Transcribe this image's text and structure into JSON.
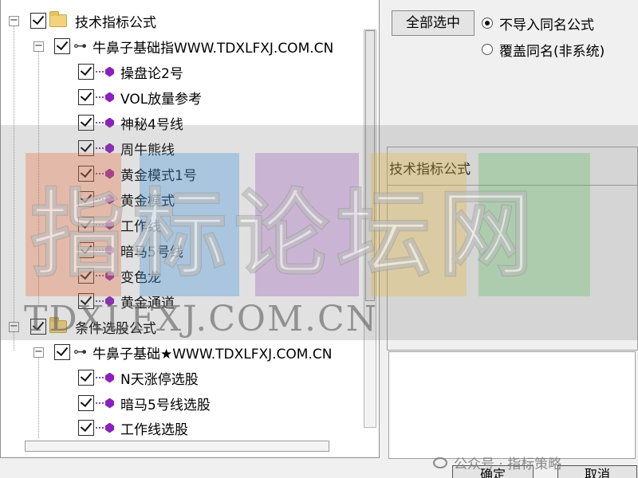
{
  "tree": {
    "groups": [
      {
        "label": "技术指标公式",
        "checked": true,
        "subgroup": {
          "label": "牛鼻子基础指WWW.TDXLFXJ.COM.CN",
          "checked": true,
          "items": [
            {
              "label": "操盘论2号",
              "checked": true
            },
            {
              "label": "VOL放量参考",
              "checked": true
            },
            {
              "label": "神秘4号线",
              "checked": true
            },
            {
              "label": "周牛熊线",
              "checked": true
            },
            {
              "label": "黄金模式1号",
              "checked": true
            },
            {
              "label": "黄金模式",
              "checked": true
            },
            {
              "label": "工作线",
              "checked": true
            },
            {
              "label": "暗马5号线",
              "checked": true
            },
            {
              "label": "变色龙",
              "checked": true
            },
            {
              "label": "黄金通道",
              "checked": true
            }
          ]
        }
      },
      {
        "label": "条件选股公式",
        "checked": true,
        "subgroup": {
          "label": "牛鼻子基础★WWW.TDXLFXJ.COM.CN",
          "checked": true,
          "items": [
            {
              "label": "N天涨停选股",
              "checked": true
            },
            {
              "label": "暗马5号线选股",
              "checked": true
            },
            {
              "label": "工作线选股",
              "checked": true
            }
          ]
        }
      }
    ]
  },
  "right_panel": {
    "select_all_label": "全部选中",
    "radio_options": [
      {
        "label": "不导入同名公式",
        "selected": true
      },
      {
        "label": "覆盖同名(非系统)",
        "selected": false
      }
    ],
    "info_title": "技术指标公式"
  },
  "bottom_buttons": {
    "ok_label": "确定",
    "cancel_label": "取消"
  },
  "watermark": {
    "logo_text": "指标论坛网",
    "url_text": "TDXLFXJ.COM.CN",
    "credit_text": "公众号 · 指标策略"
  },
  "colors": {
    "gem": "#8c1fbf",
    "folder": "#f3d37a",
    "panel_bg": "#ffffff",
    "window_bg": "#f0f0f0"
  }
}
